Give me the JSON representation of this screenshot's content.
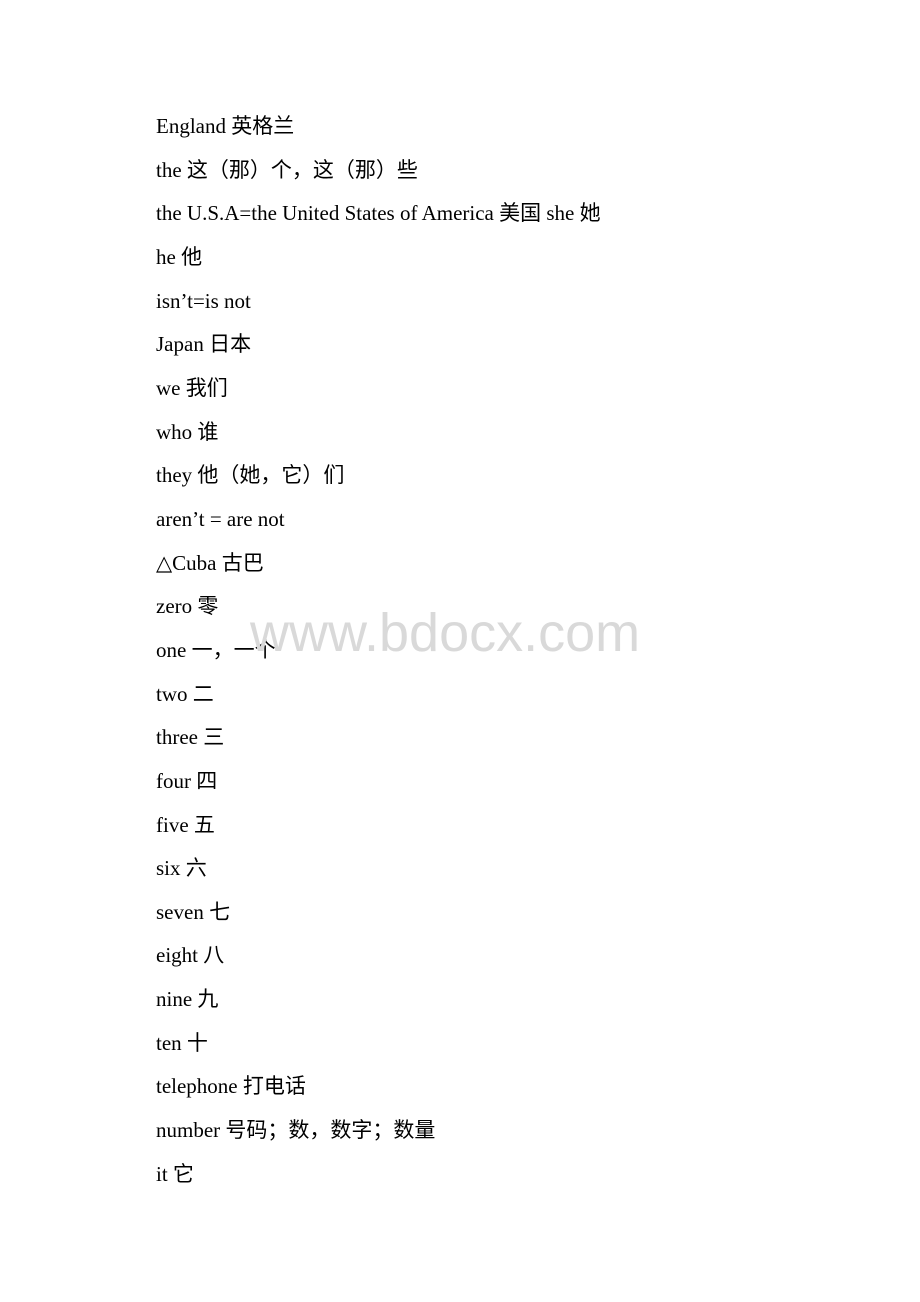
{
  "document": {
    "lines": [
      "England 英格兰",
      "the 这（那）个，这（那）些",
      "the U.S.A=the United States of America 美国 she 她",
      "he 他",
      "isn’t=is not",
      "Japan 日本",
      "we 我们",
      "who 谁",
      "they 他（她，它）们",
      "aren’t = are not",
      "△Cuba 古巴",
      "zero 零",
      "one 一，一个",
      "two 二",
      "three 三",
      "four 四",
      "five 五",
      "six 六",
      "seven 七",
      "eight 八",
      "nine 九",
      "ten 十",
      "telephone 打电话",
      "number 号码；数，数字；数量",
      "it 它"
    ]
  },
  "watermark": {
    "text": "www.bdocx.com",
    "color": "#d9d9d9"
  }
}
